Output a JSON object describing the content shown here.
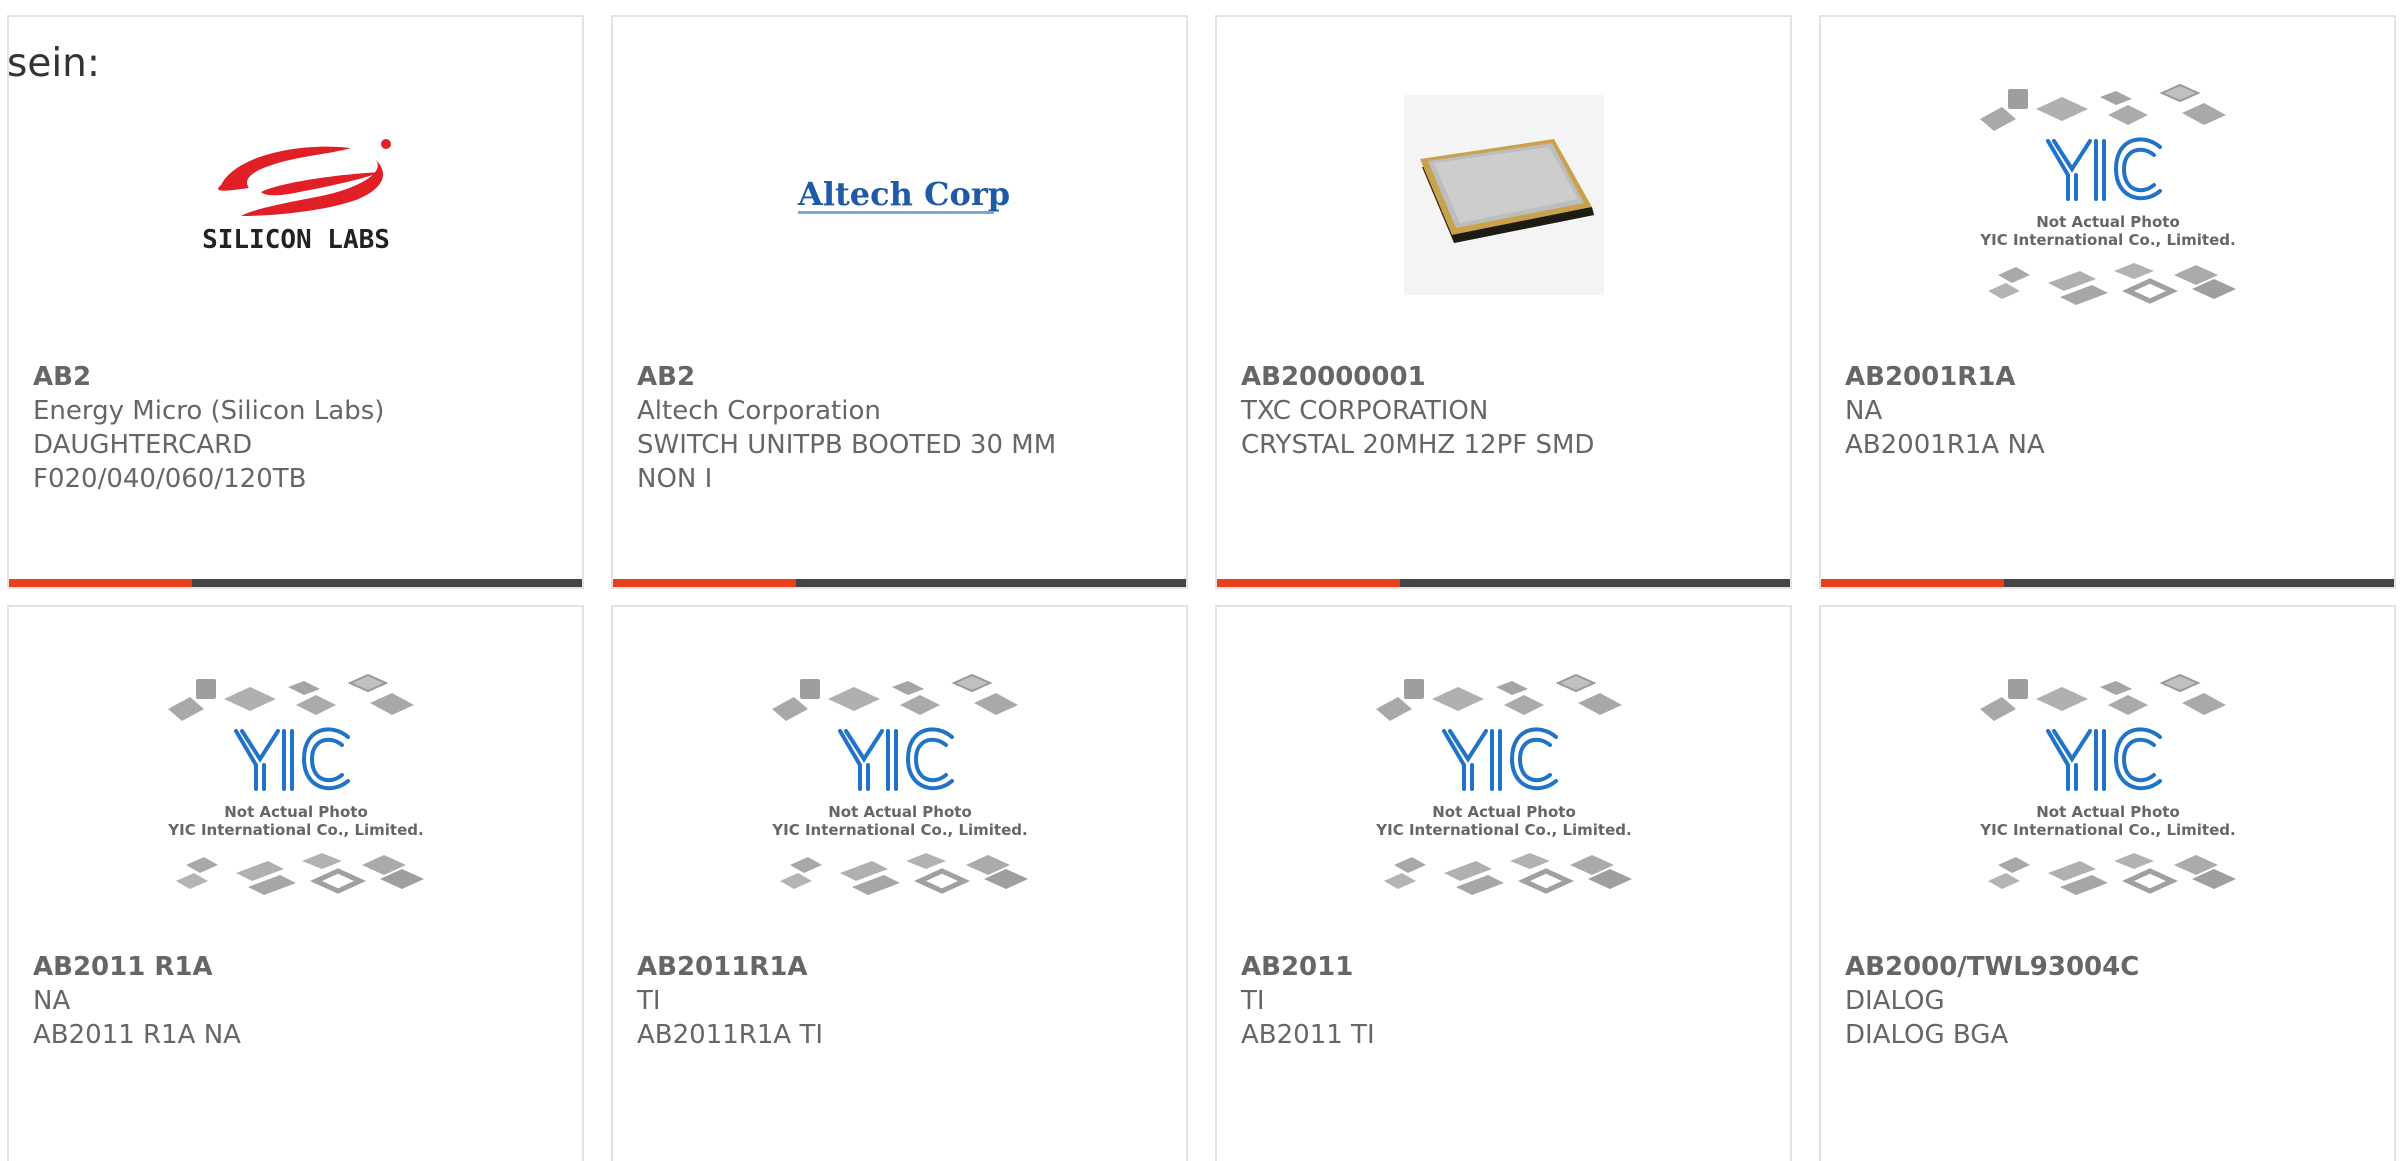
{
  "lead_text": "sein:",
  "colors": {
    "accent": "#e8401c",
    "bar": "#444444",
    "text": "#666666",
    "border": "#e3e3e3",
    "yic_blue": "#1f73c9",
    "silicon_red": "#e11f26"
  },
  "placeholder": {
    "line1": "Not Actual Photo",
    "line2": "YIC International Co., Limited."
  },
  "logos": {
    "silicon_labs": "SILICON LABS",
    "altech": "Altech Corp."
  },
  "products": [
    {
      "part": "AB2",
      "manufacturer": "Energy Micro (Silicon Labs)",
      "desc1": "DAUGHTERCARD",
      "desc2": "F020/040/060/120TB",
      "image": "silicon-labs-logo"
    },
    {
      "part": "AB2",
      "manufacturer": "Altech Corporation",
      "desc1": "SWITCH UNITPB BOOTED 30 MM",
      "desc2": "NON I",
      "image": "altech-logo"
    },
    {
      "part": "AB20000001",
      "manufacturer": "TXC CORPORATION",
      "desc1": "CRYSTAL 20MHZ 12PF SMD",
      "desc2": "",
      "image": "crystal-photo"
    },
    {
      "part": "AB2001R1A",
      "manufacturer": "NA",
      "desc1": "AB2001R1A NA",
      "desc2": "",
      "image": "yic-placeholder"
    },
    {
      "part": "AB2011 R1A",
      "manufacturer": "NA",
      "desc1": "AB2011 R1A NA",
      "desc2": "",
      "image": "yic-placeholder"
    },
    {
      "part": "AB2011R1A",
      "manufacturer": "TI",
      "desc1": "AB2011R1A TI",
      "desc2": "",
      "image": "yic-placeholder"
    },
    {
      "part": "AB2011",
      "manufacturer": "TI",
      "desc1": "AB2011 TI",
      "desc2": "",
      "image": "yic-placeholder"
    },
    {
      "part": "AB2000/TWL93004C",
      "manufacturer": "DIALOG",
      "desc1": "DIALOG BGA",
      "desc2": "",
      "image": "yic-placeholder"
    }
  ]
}
